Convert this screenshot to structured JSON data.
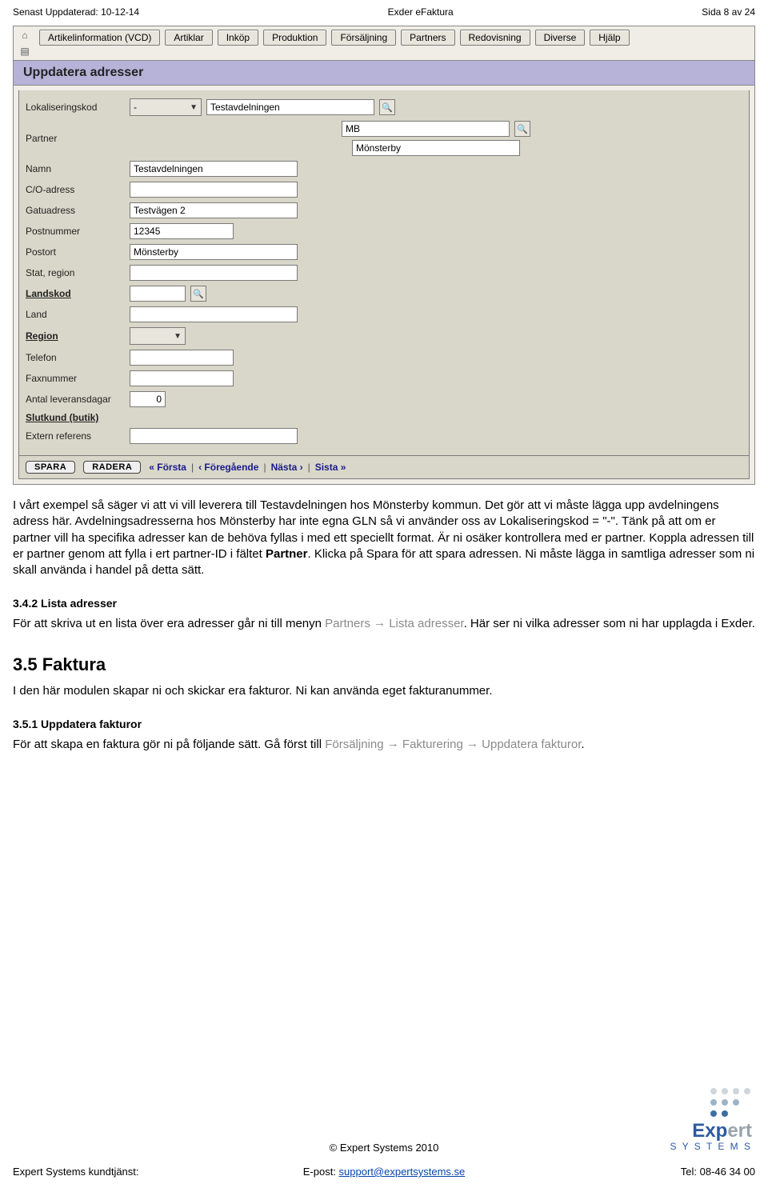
{
  "doc_header": {
    "left": "Senast Uppdaterad: 10-12-14",
    "center": "Exder eFaktura",
    "right": "Sida 8 av 24"
  },
  "screenshot": {
    "menus": [
      "Artikelinformation (VCD)",
      "Artiklar",
      "Inköp",
      "Produktion",
      "Försäljning",
      "Partners",
      "Redovisning",
      "Diverse",
      "Hjälp"
    ],
    "panel_title": "Uppdatera adresser",
    "labels": {
      "lokaliseringskod": "Lokaliseringskod",
      "partner": "Partner",
      "namn": "Namn",
      "co": "C/O-adress",
      "gatu": "Gatuadress",
      "postnummer": "Postnummer",
      "postort": "Postort",
      "stat": "Stat, region",
      "landkod": "Landskod",
      "land": "Land",
      "region": "Region",
      "telefon": "Telefon",
      "fax": "Faxnummer",
      "levdagar": "Antal leveransdagar",
      "slutkund": "Slutkund (butik)",
      "extern": "Extern referens"
    },
    "values": {
      "lokaliseringskod_sel": "-",
      "lokaliseringskod_text": "Testavdelningen",
      "partner_code": "MB",
      "partner_name": "Mönsterby",
      "namn": "Testavdelningen",
      "co": "",
      "gatu": "Testvägen 2",
      "postnummer": "12345",
      "postort": "Mönsterby",
      "stat": "",
      "landkod": "",
      "land": "",
      "region": "",
      "telefon": "",
      "fax": "",
      "levdagar": "0",
      "slutkund": "",
      "extern": ""
    },
    "buttons": {
      "spara": "SPARA",
      "radera": "RADERA"
    },
    "pager": {
      "first": "« Första",
      "prev": "‹ Föregående",
      "next": "Nästa ›",
      "last": "Sista »",
      "sep": "|"
    }
  },
  "body": {
    "p1a": "I vårt exempel så säger vi att vi vill leverera till Testavdelningen hos Mönsterby kommun. Det gör att vi måste lägga upp avdelningens adress här. Avdelningsadresserna hos Mönsterby har inte egna GLN så vi använder oss av Lokaliseringskod = \"-\". Tänk på att om er partner vill ha specifika adresser kan de behöva fyllas i med ett speciellt format. Är ni osäker kontrollera med er partner. Koppla adressen till er partner genom att fylla i ert partner-ID i fältet ",
    "p1_strong": "Partner",
    "p1b": ". Klicka på Spara för att spara adressen. Ni måste lägga in samtliga adresser som ni skall använda i handel på detta sätt.",
    "h342": "3.4.2      Lista adresser",
    "p2a": "För att skriva ut en lista över era adresser går ni till menyn ",
    "p2_gray1": "Partners",
    "arrow": "→",
    "p2_gray2": "Lista adresser",
    "p2b": ". Här ser ni vilka adresser som ni har upplagda i Exder.",
    "h35": "3.5        Faktura",
    "p3": "I den här modulen skapar ni och skickar era fakturor. Ni kan använda eget fakturanummer.",
    "h351": "3.5.1      Uppdatera fakturor",
    "p4a": "För att skapa en faktura gör ni på följande sätt. Gå först till ",
    "p4_gray1": "Försäljning",
    "p4_gray2": "Fakturering",
    "p4_gray3": "Uppdatera fakturor",
    "p4_dot": "."
  },
  "footer": {
    "copyright": "© Expert Systems 2010",
    "left": "Expert Systems kundtjänst:",
    "center_label": "E-post: ",
    "center_link": "support@expertsystems.se",
    "right": "Tel: 08-46 34 00"
  },
  "logo": {
    "word1": "Expert",
    "word2": "S Y S T E M S"
  }
}
